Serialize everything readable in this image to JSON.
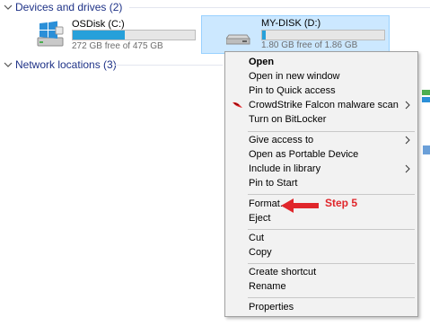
{
  "sections": {
    "devices": {
      "title": "Devices and drives (2)"
    },
    "network": {
      "title": "Network locations (3)"
    }
  },
  "drives": [
    {
      "name": "OSDisk (C:)",
      "free_text": "272 GB free of 475 GB",
      "used_fraction": 0.43
    },
    {
      "name": "MY-DISK (D:)",
      "free_text": "1.80 GB free of 1.86 GB",
      "used_fraction": 0.03
    }
  ],
  "menu": {
    "open": "Open",
    "open_new_window": "Open in new window",
    "pin_quick_access": "Pin to Quick access",
    "crowdstrike_scan": "CrowdStrike Falcon malware scan",
    "turn_on_bitlocker": "Turn on BitLocker",
    "give_access_to": "Give access to",
    "open_portable": "Open as Portable Device",
    "include_library": "Include in library",
    "pin_to_start": "Pin to Start",
    "format": "Format...",
    "eject": "Eject",
    "cut": "Cut",
    "copy": "Copy",
    "create_shortcut": "Create shortcut",
    "rename": "Rename",
    "properties": "Properties"
  },
  "annotation": {
    "label": "Step 5",
    "color": "#e0262b"
  },
  "colors": {
    "accent": "#26a0da",
    "selection": "#cce8ff",
    "header": "#1e3287"
  }
}
